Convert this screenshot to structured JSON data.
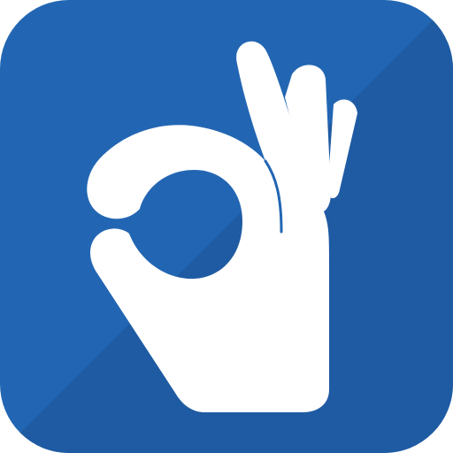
{
  "icon": {
    "name": "ok-hand-gesture-icon",
    "colors": {
      "tile_light": "#2266B3",
      "tile_dark": "#1F5BA3",
      "hand": "#FFFFFF"
    }
  }
}
